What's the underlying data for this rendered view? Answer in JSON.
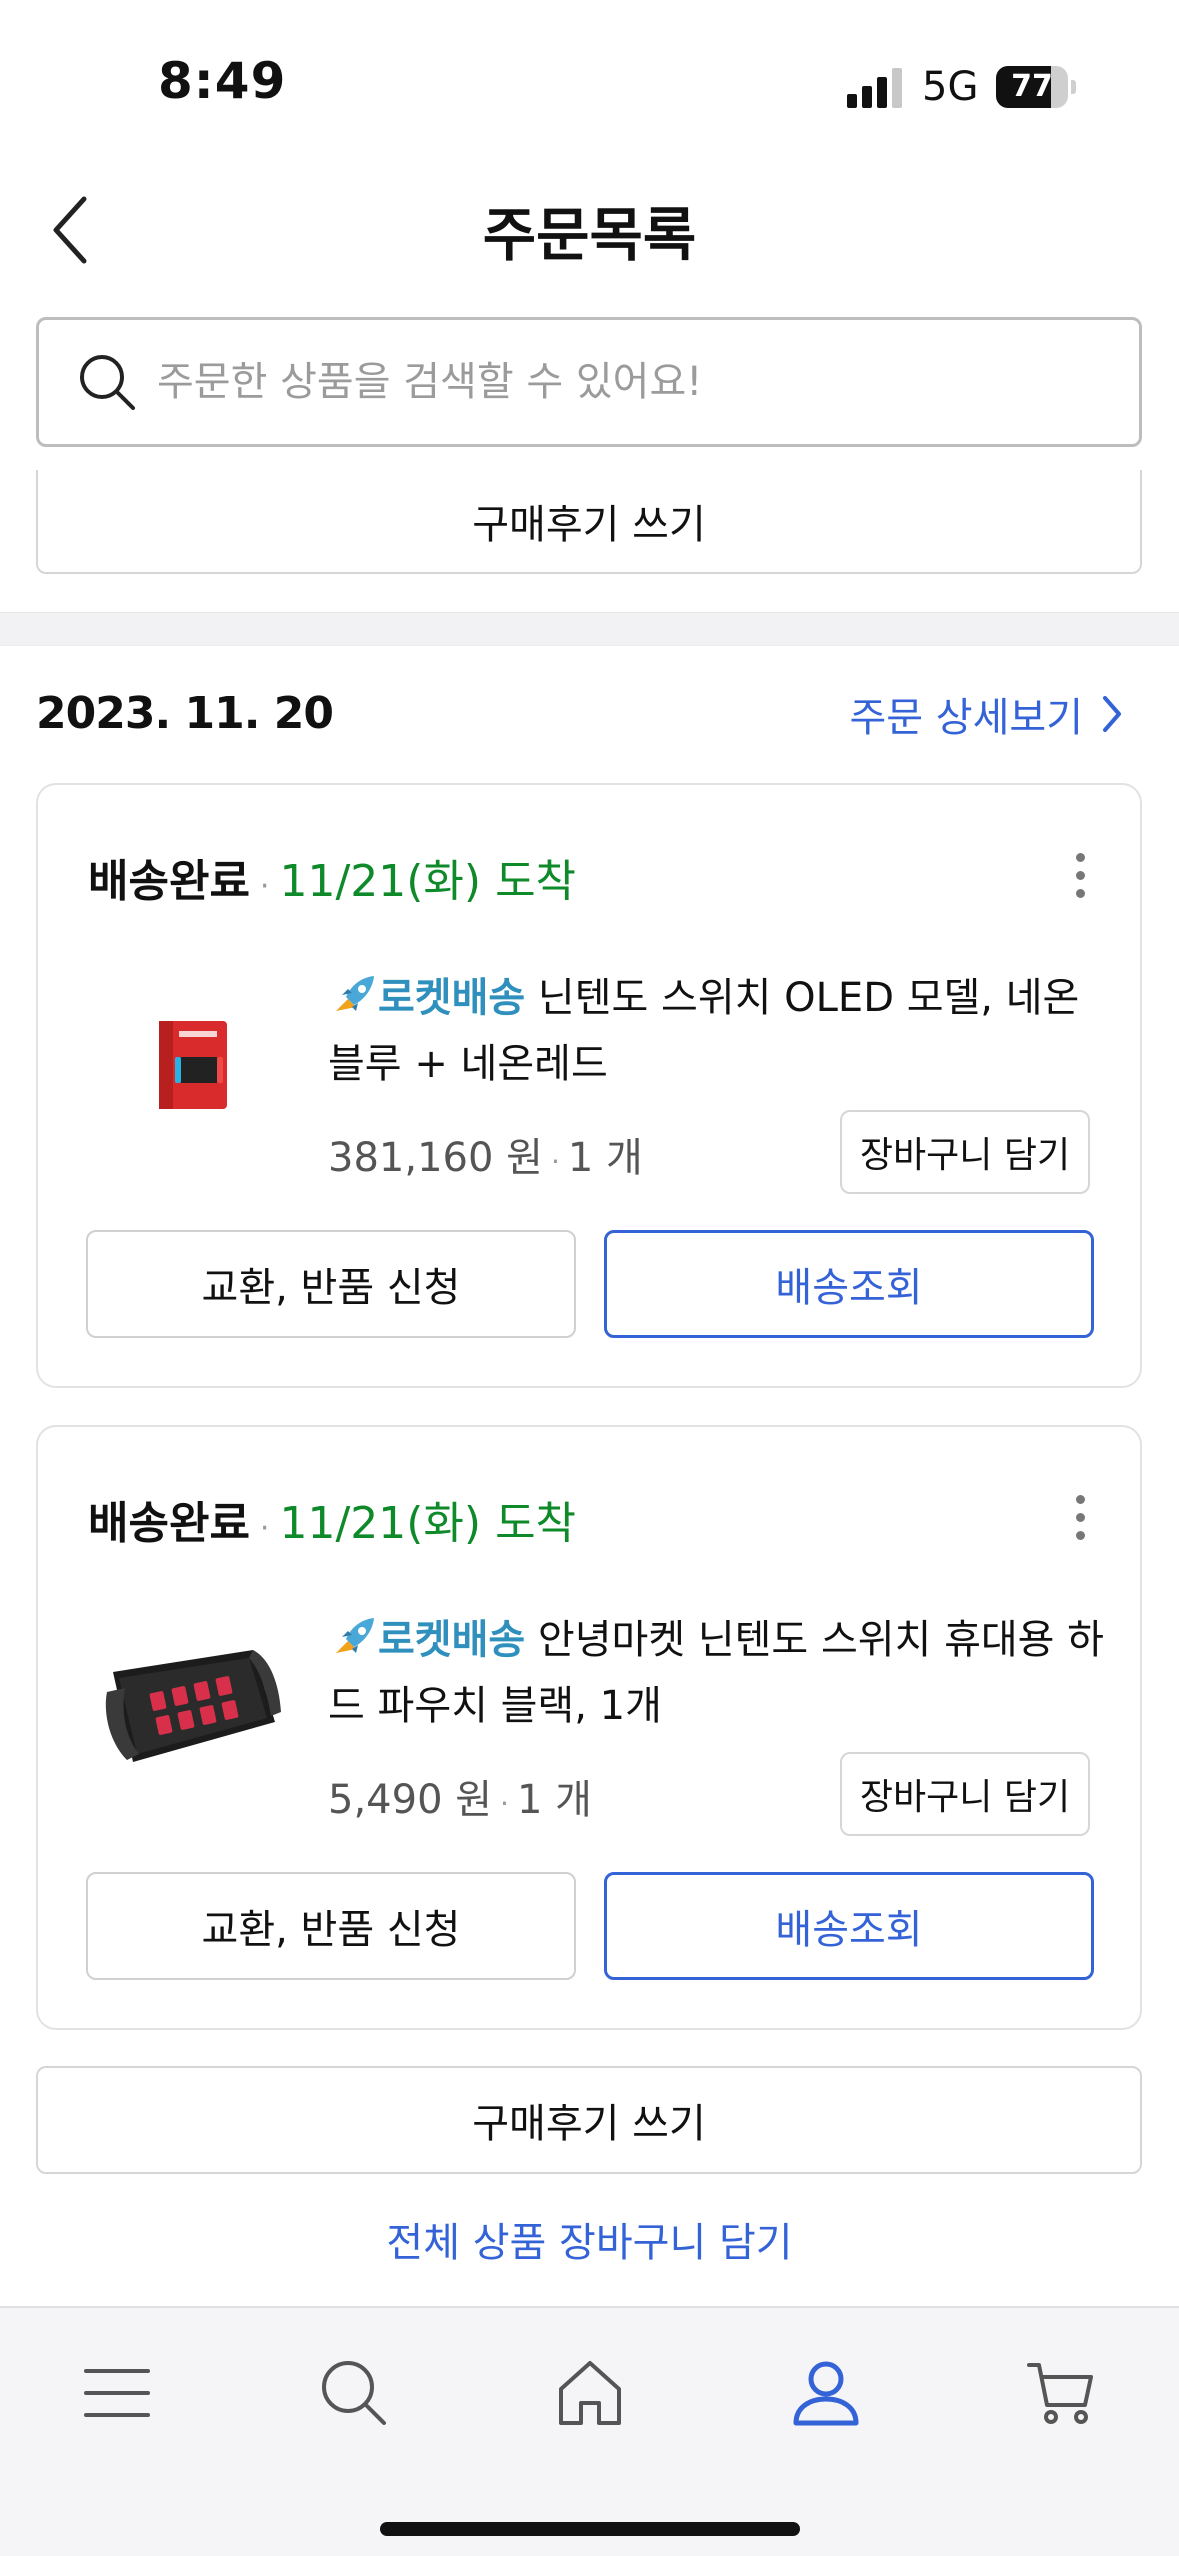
{
  "status_bar": {
    "time": "8:49",
    "network": "5G",
    "battery": "77",
    "battery_level": 0.77
  },
  "header": {
    "title": "주문목록",
    "back_icon": "chevron-left-icon"
  },
  "search": {
    "placeholder": "주문한 상품을 검색할 수 있어요!",
    "value": "",
    "icon": "search-icon"
  },
  "top_review_button": "구매후기 쓰기",
  "order": {
    "date": "2023. 11. 20",
    "detail_link": "주문 상세보기",
    "items": [
      {
        "status": "배송완료",
        "separator": "·",
        "eta": "11/21(화) 도착",
        "badge": "로켓배송",
        "name": "닌텐도 스위치 OLED 모델, 네온블루 + 네온레드",
        "price": "381,160 원",
        "qty": "1 개",
        "cart_button": "장바구니 담기",
        "exchange_button": "교환, 반품 신청",
        "track_button": "배송조회",
        "thumb_icon": "nintendo-switch-box-icon"
      },
      {
        "status": "배송완료",
        "separator": "·",
        "eta": "11/21(화) 도착",
        "badge": "로켓배송",
        "name": "안녕마켓 닌텐도 스위치 휴대용 하드 파우치 블랙, 1개",
        "price": "5,490 원",
        "qty": "1 개",
        "cart_button": "장바구니 담기",
        "exchange_button": "교환, 반품 신청",
        "track_button": "배송조회",
        "thumb_icon": "switch-pouch-icon"
      }
    ],
    "review_button": "구매후기 쓰기",
    "add_all_to_cart": "전체 상품 장바구니 담기"
  },
  "tab_bar": {
    "items": [
      {
        "icon": "menu-icon",
        "active": false
      },
      {
        "icon": "search-icon",
        "active": false
      },
      {
        "icon": "home-icon",
        "active": false
      },
      {
        "icon": "user-icon",
        "active": true
      },
      {
        "icon": "cart-icon",
        "active": false
      }
    ]
  },
  "colors": {
    "accent_blue": "#3463d8",
    "eta_green": "#0f8a2a",
    "rocket_blue": "#2f8fbd"
  }
}
